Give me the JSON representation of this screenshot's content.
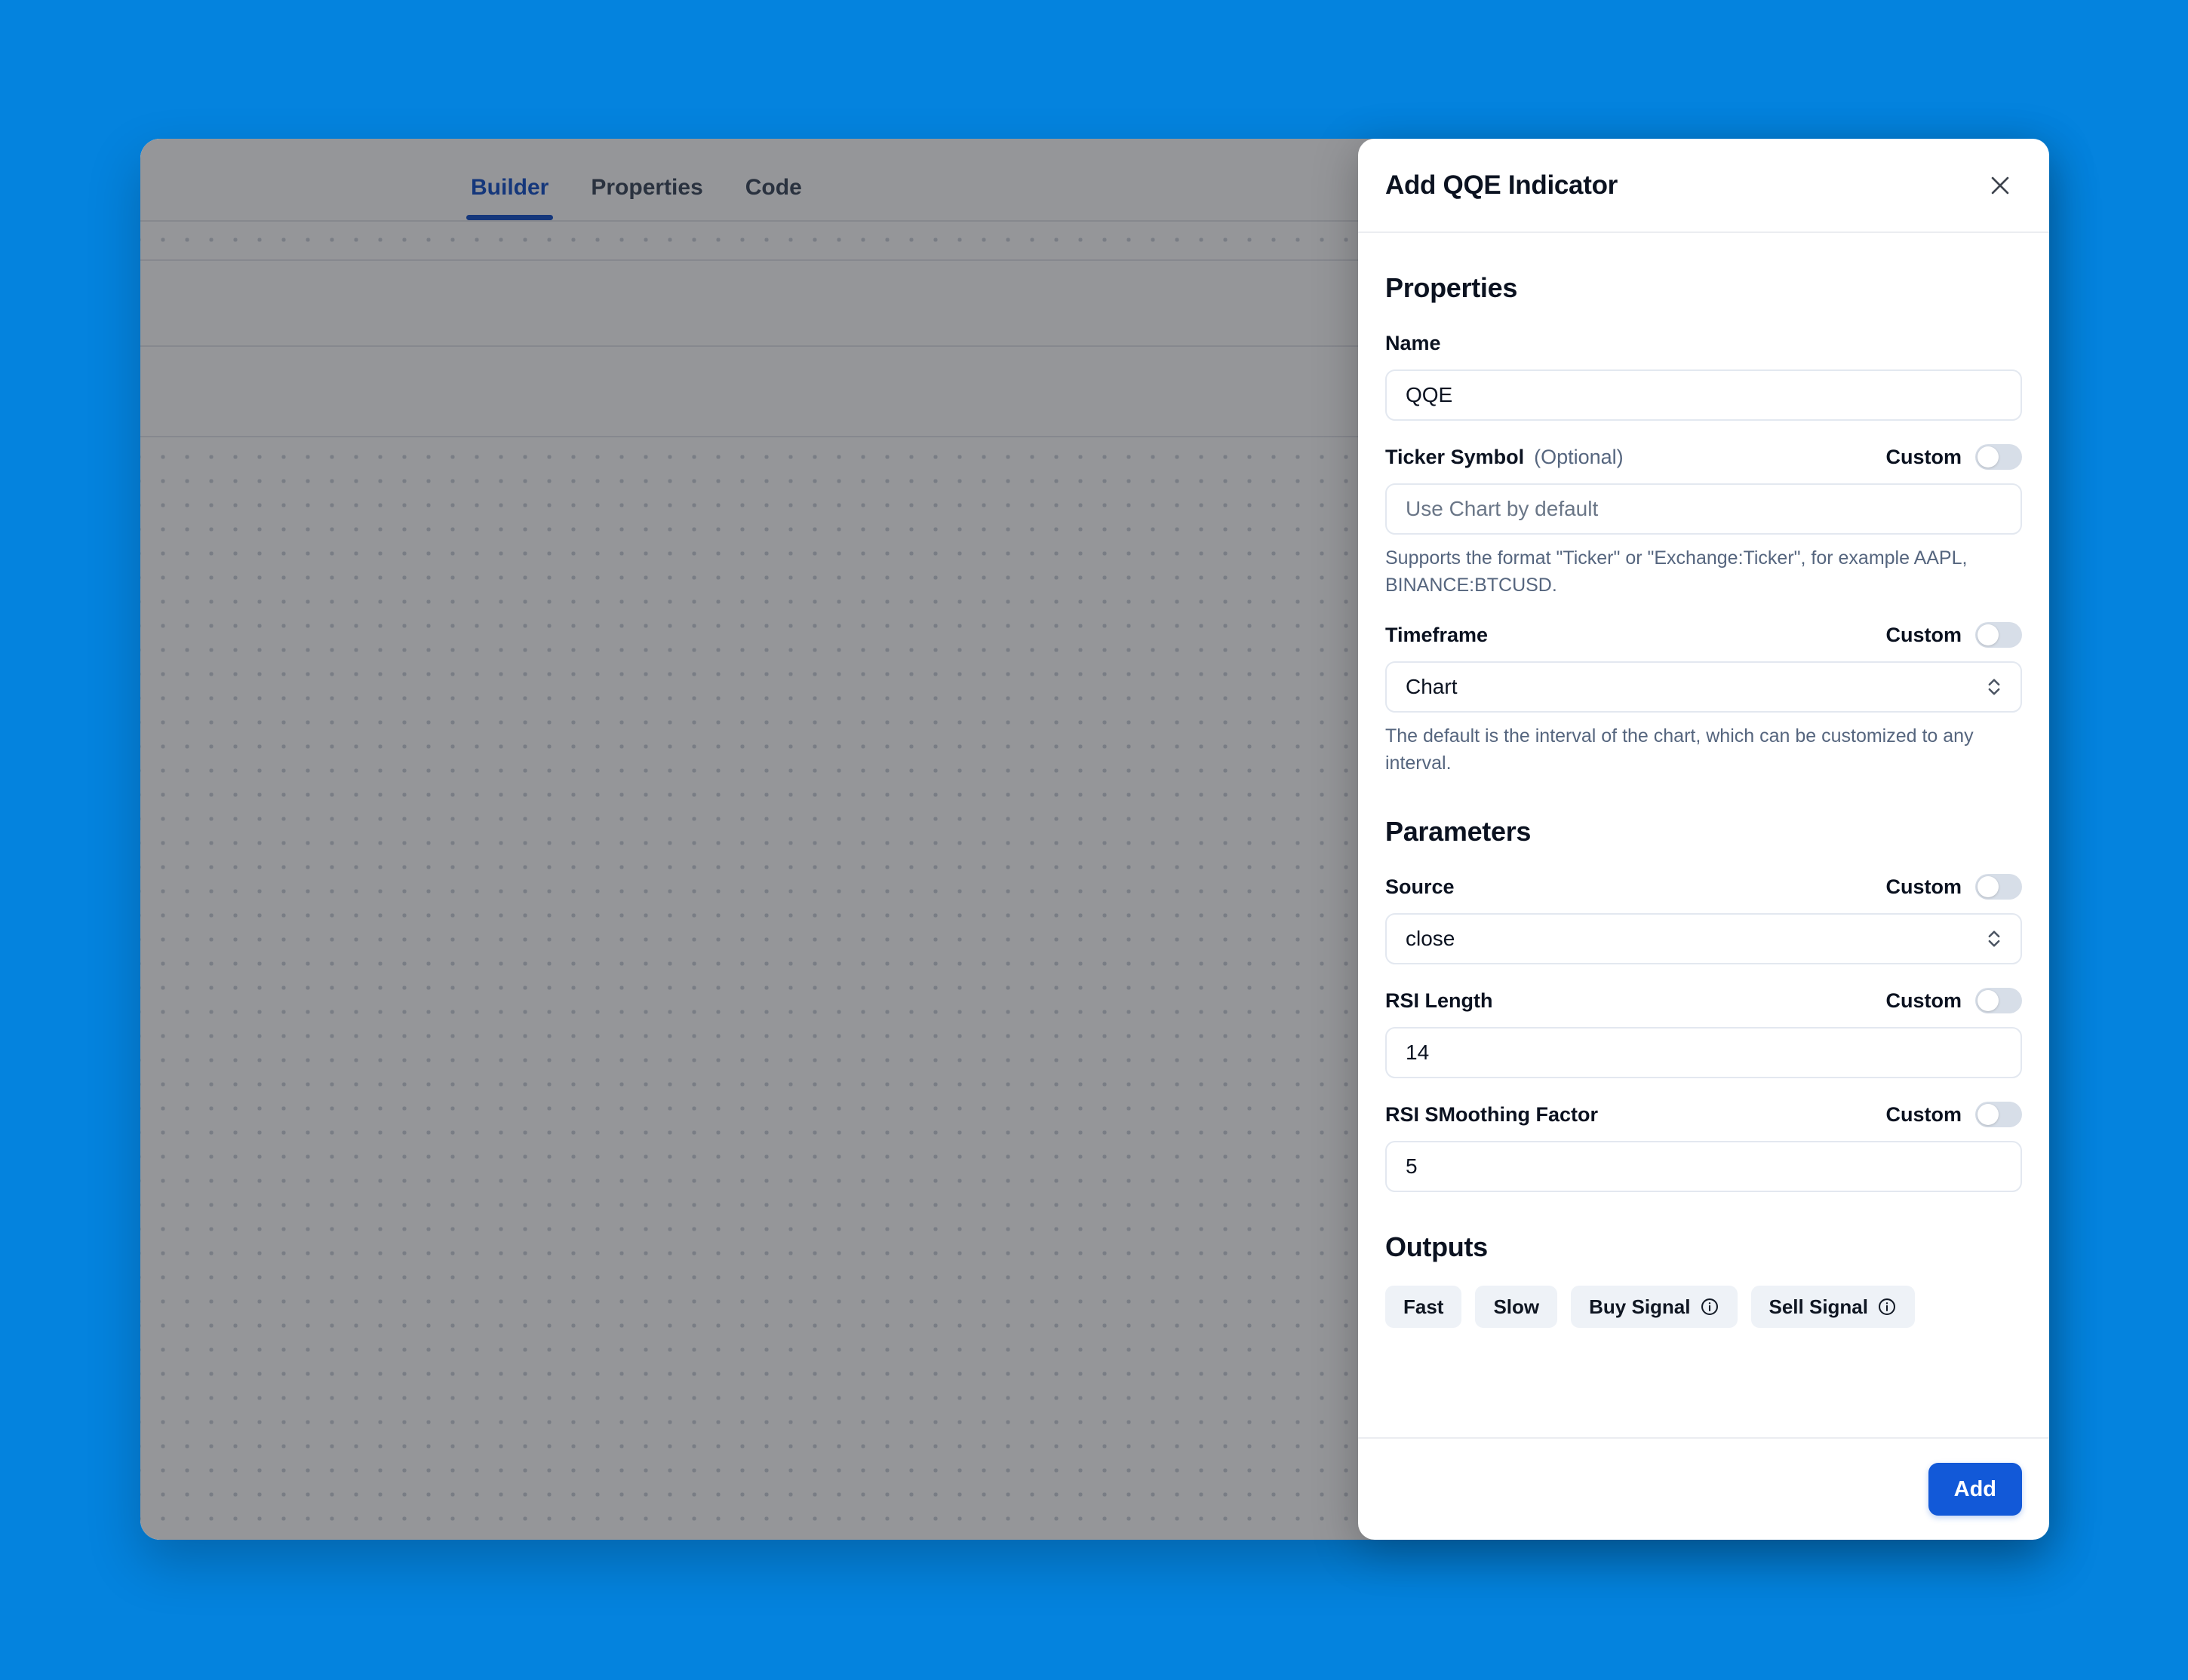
{
  "background": {
    "color": "#0483DE"
  },
  "app_window": {
    "tabs": [
      {
        "label": "Builder",
        "active": true
      },
      {
        "label": "Properties",
        "active": false
      },
      {
        "label": "Code",
        "active": false
      }
    ],
    "toolbar_icons": [
      "plus-icon",
      "sort-arrows-icon",
      "chevron-icon"
    ]
  },
  "modal": {
    "title": "Add QQE Indicator",
    "close_icon": "close-icon",
    "sections": {
      "properties": {
        "heading": "Properties",
        "name": {
          "label": "Name",
          "value": "QQE"
        },
        "ticker_symbol": {
          "label": "Ticker Symbol",
          "optional_note": "(Optional)",
          "custom_label": "Custom",
          "custom_enabled": false,
          "placeholder": "Use Chart by default",
          "value": "",
          "help": "Supports the format \"Ticker\" or \"Exchange:Ticker\", for example AAPL, BINANCE:BTCUSD."
        },
        "timeframe": {
          "label": "Timeframe",
          "custom_label": "Custom",
          "custom_enabled": false,
          "value": "Chart",
          "help": "The default is the interval of the chart, which can be customized to any interval."
        }
      },
      "parameters": {
        "heading": "Parameters",
        "source": {
          "label": "Source",
          "custom_label": "Custom",
          "custom_enabled": false,
          "value": "close"
        },
        "rsi_length": {
          "label": "RSI Length",
          "custom_label": "Custom",
          "custom_enabled": false,
          "value": "14"
        },
        "rsi_smoothing_factor": {
          "label": "RSI SMoothing Factor",
          "custom_label": "Custom",
          "custom_enabled": false,
          "value": "5"
        }
      },
      "outputs": {
        "heading": "Outputs",
        "chips": [
          {
            "label": "Fast",
            "has_info": false
          },
          {
            "label": "Slow",
            "has_info": false
          },
          {
            "label": "Buy Signal",
            "has_info": true
          },
          {
            "label": "Sell Signal",
            "has_info": true
          }
        ]
      }
    },
    "footer": {
      "add_label": "Add",
      "add_color": "#1259D8"
    }
  }
}
